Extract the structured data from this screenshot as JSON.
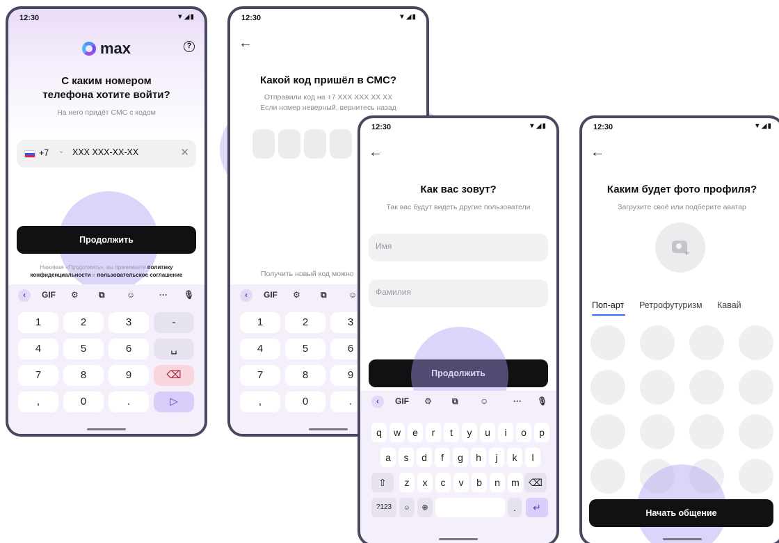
{
  "screen1": {
    "time": "12:30",
    "status_icons": "▼◢▮",
    "logo_text": "max",
    "help": "?",
    "title_line1": "С каким номером",
    "title_line2": "телефона хотите войти?",
    "subtitle": "На него придёт СМС с кодом",
    "country_code": "+7",
    "phone_value": "XXX XXX-XX-XX",
    "continue": "Продолжить",
    "legal_prefix": "Нажимая «Продолжить», вы принимаете ",
    "legal_policy": "политику конфиденциальности",
    "legal_and": " и ",
    "legal_agreement": "пользовательское соглашение",
    "toolbar": [
      "GIF"
    ],
    "numpad": [
      "1",
      "2",
      "3",
      "-",
      "4",
      "5",
      "6",
      "␣",
      "7",
      "8",
      "9",
      "⌫",
      ",",
      "0",
      ".",
      "▷"
    ]
  },
  "screen2": {
    "time": "12:30",
    "status_icons": "▼◢▮",
    "title": "Какой код пришёл в СМС?",
    "subtitle_line1": "Отправили код на +7 XXX XXX XX XX",
    "subtitle_line2": "Если номер неверный, вернитесь назад",
    "resend": "Получить новый код можно",
    "numpad": [
      "1",
      "2",
      "3",
      "4",
      "5",
      "6",
      "7",
      "8",
      "9",
      ",",
      "0",
      "."
    ]
  },
  "screen3": {
    "time": "12:30",
    "status_icons": "▼◢▮",
    "title": "Как вас зовут?",
    "subtitle": "Так вас будут видеть другие пользователи",
    "first_name_placeholder": "Имя",
    "last_name_placeholder": "Фамилия",
    "continue": "Продолжить",
    "row1": [
      "q",
      "w",
      "e",
      "r",
      "t",
      "y",
      "u",
      "i",
      "o",
      "p"
    ],
    "row2": [
      "a",
      "s",
      "d",
      "f",
      "g",
      "h",
      "j",
      "k",
      "l"
    ],
    "row3": [
      "z",
      "x",
      "c",
      "v",
      "b",
      "n",
      "m"
    ],
    "sym_key": "?123"
  },
  "screen4": {
    "time": "12:30",
    "status_icons": "▼◢▮",
    "title": "Каким будет фото профиля?",
    "subtitle": "Загрузите своё или подберите аватар",
    "tabs": [
      "Поп-арт",
      "Ретрофутуризм",
      "Кавай"
    ],
    "start": "Начать общение"
  },
  "colors": {
    "accent": "#2f6df6",
    "dark_button": "#111114",
    "keyboard_bg": "#f5effb",
    "highlight": "#aa9ef0"
  }
}
